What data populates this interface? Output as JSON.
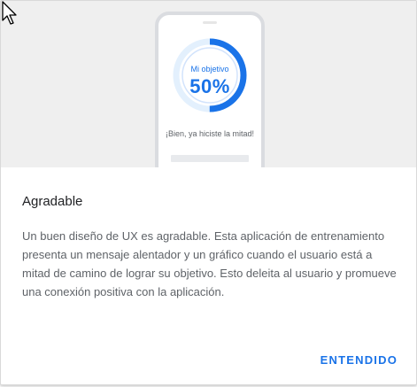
{
  "illustration": {
    "goal_caption": "Mi objetivo",
    "goal_value": "50%",
    "goal_progress": 0.5,
    "message": "¡Bien, ya hiciste la mitad!",
    "accent_color": "#1a73e8"
  },
  "dialog": {
    "title": "Agradable",
    "body": "Un buen diseño de UX es agradable. Esta aplicación de entrenamiento presenta un mensaje alentador y un gráfico cuando el usuario está a mitad de camino de lograr su objetivo. Esto deleita al usuario y promueve una conexión positiva con la aplicación.",
    "confirm_label": "ENTENDIDO"
  }
}
